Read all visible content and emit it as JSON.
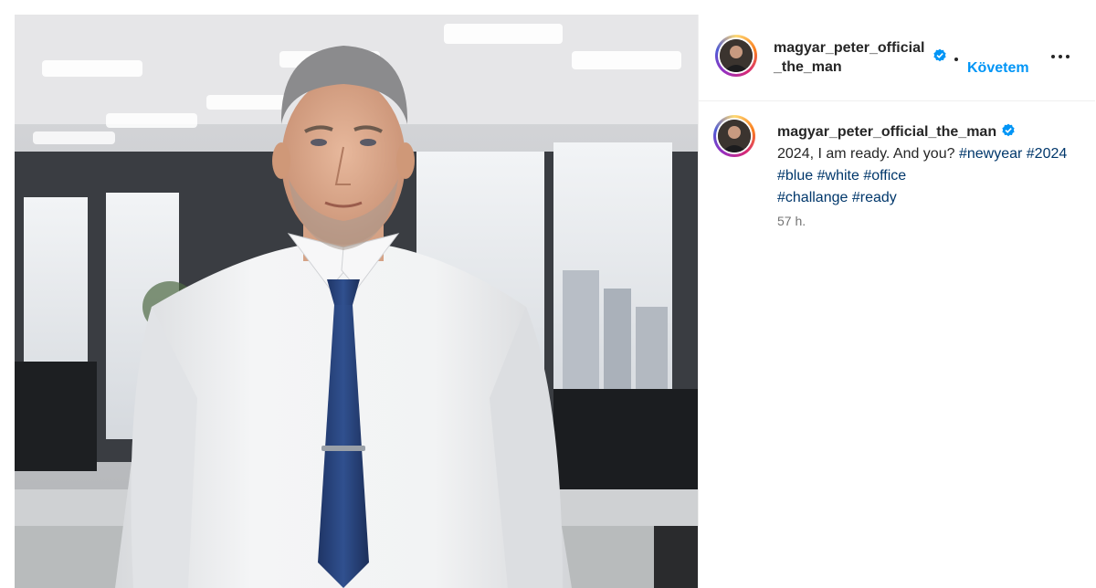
{
  "post": {
    "username": "magyar_peter_official_the_man",
    "follow_label": "Követem",
    "more_label": "•••",
    "caption": {
      "username": "magyar_peter_official_the_man",
      "text": "2024, I am ready. And you?",
      "hashtags": [
        "#newyear",
        "#2024",
        "#blue",
        "#white",
        "#office",
        "#challange",
        "#ready"
      ]
    },
    "timestamp": "57 h."
  },
  "icons": {
    "verified": "verified-badge-icon",
    "more": "more-options-icon"
  },
  "colors": {
    "link": "#0095f6",
    "hashtag": "#00376b",
    "verified": "#0095f6",
    "text": "#262626",
    "muted": "#737373"
  }
}
